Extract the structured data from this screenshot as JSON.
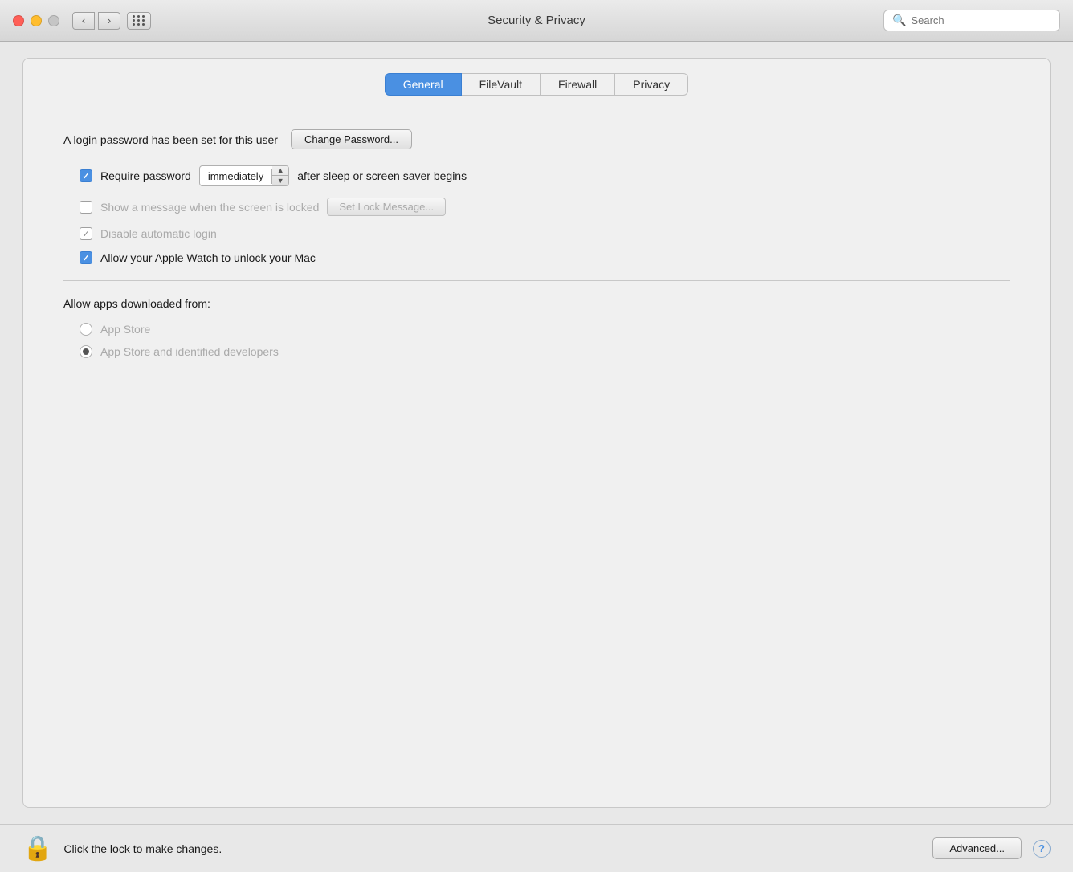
{
  "titlebar": {
    "title": "Security & Privacy",
    "search_placeholder": "Search",
    "nav_back": "‹",
    "nav_forward": "›"
  },
  "tabs": [
    {
      "id": "general",
      "label": "General",
      "active": true
    },
    {
      "id": "filevault",
      "label": "FileVault",
      "active": false
    },
    {
      "id": "firewall",
      "label": "Firewall",
      "active": false
    },
    {
      "id": "privacy",
      "label": "Privacy",
      "active": false
    }
  ],
  "general": {
    "login_password_label": "A login password has been set for this user",
    "change_password_btn": "Change Password...",
    "require_password_label": "Require password",
    "require_password_value": "immediately",
    "require_password_suffix": "after sleep or screen saver begins",
    "show_message_label": "Show a message when the screen is locked",
    "set_lock_message_btn": "Set Lock Message...",
    "disable_login_label": "Disable automatic login",
    "apple_watch_label": "Allow your Apple Watch to unlock your Mac",
    "require_password_checked": true,
    "show_message_checked": false,
    "disable_login_checked": true,
    "apple_watch_checked": true
  },
  "allow_apps": {
    "title": "Allow apps downloaded from:",
    "options": [
      {
        "id": "app_store",
        "label": "App Store",
        "selected": false
      },
      {
        "id": "app_store_identified",
        "label": "App Store and identified developers",
        "selected": true
      }
    ]
  },
  "bottom": {
    "lock_text": "Click the lock to make changes.",
    "advanced_btn": "Advanced...",
    "help_btn": "?"
  }
}
